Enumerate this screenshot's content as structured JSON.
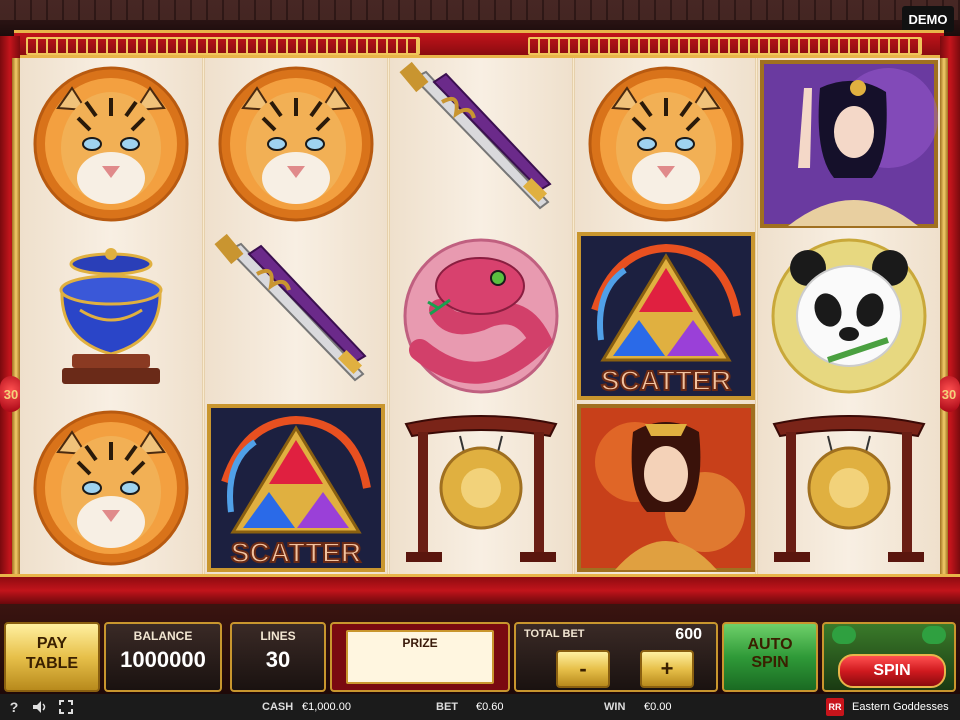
{
  "badge": {
    "demo": "DEMO"
  },
  "lanterns": {
    "left": "30",
    "right": "30"
  },
  "reels": [
    [
      "tiger-symbol",
      "vase-symbol",
      "tiger-symbol"
    ],
    [
      "tiger-symbol",
      "sword-symbol",
      "scatter-symbol"
    ],
    [
      "sword-symbol",
      "snake-symbol",
      "gong-symbol"
    ],
    [
      "tiger-symbol",
      "scatter-symbol",
      "goddess-red-symbol"
    ],
    [
      "goddess-purple-symbol",
      "panda-symbol",
      "gong-symbol"
    ]
  ],
  "symbols": {
    "scatter_text": "SCATTER"
  },
  "controls": {
    "pay_table": {
      "line1": "PAY",
      "line2": "TABLE"
    },
    "balance": {
      "label": "BALANCE",
      "value": "1000000"
    },
    "lines": {
      "label": "LINES",
      "value": "30"
    },
    "prize": {
      "label": "PRIZE",
      "value": ""
    },
    "total_bet": {
      "label": "TOTAL BET",
      "value": "600",
      "minus": "-",
      "plus": "+"
    },
    "auto_spin": {
      "line1": "AUTO",
      "line2": "SPIN"
    },
    "spin": {
      "label": "SPIN"
    }
  },
  "status": {
    "help": "?",
    "cash_label": "CASH",
    "cash_value": "€1,000.00",
    "bet_label": "BET",
    "bet_value": "€0.60",
    "win_label": "WIN",
    "win_value": "€0.00",
    "game_title": "Eastern Goddesses",
    "logo": "RR"
  },
  "colors": {
    "frame_red": "#c2141b",
    "gold": "#e8b54a",
    "auto_green": "#2f9a38",
    "spin_red": "#d01a1f"
  }
}
